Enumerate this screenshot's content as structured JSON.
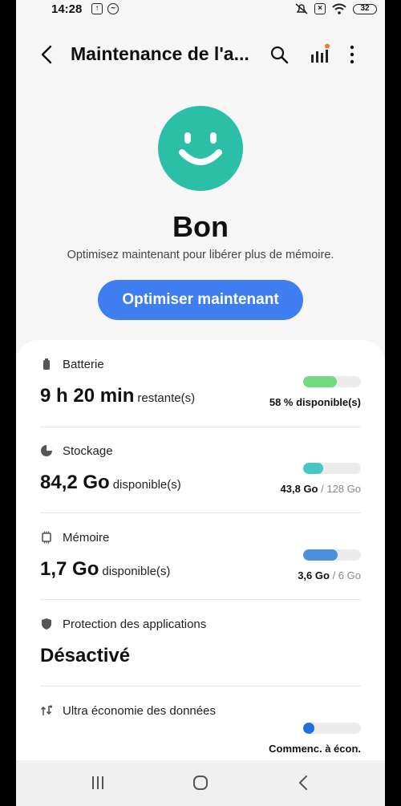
{
  "status_bar": {
    "time": "14:28",
    "battery": "32"
  },
  "header": {
    "title": "Maintenance de l'a..."
  },
  "status": {
    "title": "Bon",
    "subtitle": "Optimisez maintenant pour libérer plus de mémoire.",
    "button_label": "Optimiser maintenant",
    "face_color": "#2bbfa7"
  },
  "items": {
    "battery": {
      "label": "Batterie",
      "value": "9 h 20 min",
      "unit": "restante(s)",
      "meta": "58 % disponible(s)",
      "level": 0.58,
      "color": "#6fdc7d"
    },
    "storage": {
      "label": "Stockage",
      "value": "84,2 Go",
      "unit": "disponible(s)",
      "meta_used": "43,8 Go",
      "meta_total": "/ 128 Go",
      "level": 0.342,
      "color": "#46c6c9"
    },
    "memory": {
      "label": "Mémoire",
      "value": "1,7 Go",
      "unit": "disponible(s)",
      "meta_used": "3,6 Go",
      "meta_total": "/ 6 Go",
      "level": 0.6,
      "color": "#4a8fe0"
    },
    "protection": {
      "label": "Protection des applications",
      "value": "Désactivé"
    },
    "data_saver": {
      "label": "Ultra économie des données",
      "meta": "Commenc. à écon.",
      "color": "#1f6fe0"
    }
  },
  "icons": {
    "back": "chevron-left-icon",
    "search": "search-icon",
    "stats": "stats-icon",
    "more": "more-vertical-icon",
    "nav_recent": "recent-apps-icon",
    "nav_home": "home-icon",
    "nav_back": "back-icon"
  }
}
